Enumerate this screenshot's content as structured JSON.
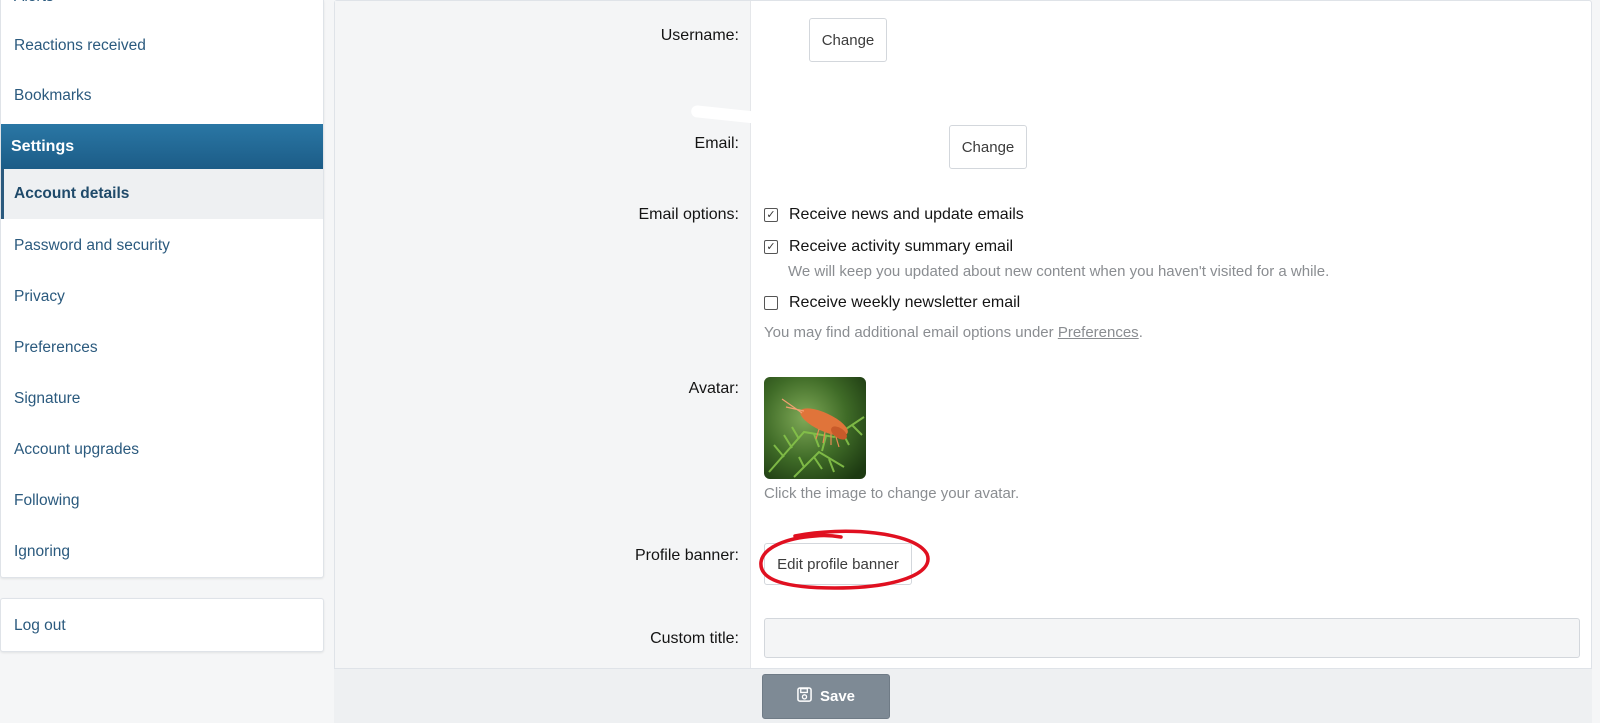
{
  "sidebar": {
    "items": [
      {
        "label": "Alerts"
      },
      {
        "label": "Reactions received"
      },
      {
        "label": "Bookmarks"
      }
    ],
    "settings_header": "Settings",
    "settings_items": [
      {
        "label": "Account details"
      },
      {
        "label": "Password and security"
      },
      {
        "label": "Privacy"
      },
      {
        "label": "Preferences"
      },
      {
        "label": "Signature"
      },
      {
        "label": "Account upgrades"
      },
      {
        "label": "Following"
      },
      {
        "label": "Ignoring"
      }
    ],
    "logout_label": "Log out"
  },
  "form": {
    "username": {
      "label": "Username:",
      "change_label": "Change"
    },
    "email": {
      "label": "Email:",
      "change_label": "Change"
    },
    "email_options": {
      "label": "Email options:",
      "options": [
        {
          "label": "Receive news and update emails",
          "checked": true
        },
        {
          "label": "Receive activity summary email",
          "checked": true,
          "hint": "We will keep you updated about new content when you haven't visited for a while."
        },
        {
          "label": "Receive weekly newsletter email",
          "checked": false
        }
      ],
      "footer_prefix": "You may find additional email options under ",
      "footer_link": "Preferences",
      "footer_suffix": "."
    },
    "avatar": {
      "label": "Avatar:",
      "hint": "Click the image to change your avatar."
    },
    "profile_banner": {
      "label": "Profile banner:",
      "button_label": "Edit profile banner"
    },
    "custom_title": {
      "label": "Custom title:",
      "value": "",
      "placeholder": ""
    }
  },
  "footer": {
    "save_label": "Save"
  },
  "colors": {
    "link": "#2b5a7e",
    "header_bg": "#1c5c87",
    "save_bg": "#7e8a95",
    "annotation": "#e01020"
  },
  "icons": {
    "save": "floppy-disk-icon",
    "check": "check-icon"
  }
}
